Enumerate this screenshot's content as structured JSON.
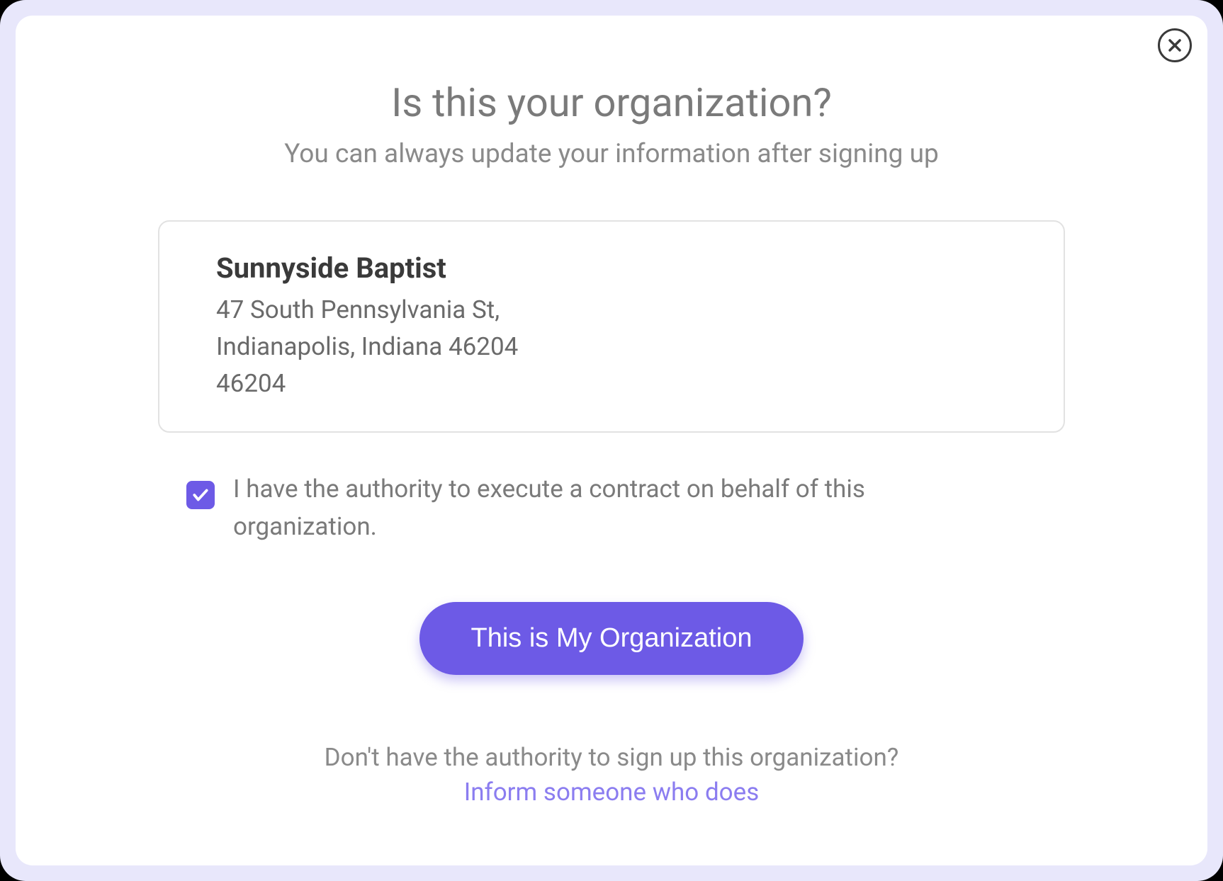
{
  "modal": {
    "title": "Is this your organization?",
    "subtitle": "You can always update your information after signing up",
    "organization": {
      "name": "Sunnyside Baptist",
      "address_line1": "47 South Pennsylvania St,",
      "address_line2": "Indianapolis, Indiana 46204",
      "address_line3": "46204"
    },
    "authority_checkbox": {
      "checked": true,
      "label": "I have the authority to execute a contract on behalf of this organization."
    },
    "confirm_button": "This is My Organization",
    "footer": {
      "question": "Don't have the authority to sign up this organization?",
      "link": "Inform someone who does"
    }
  },
  "colors": {
    "accent": "#6d5ae6",
    "backdrop": "#e8e7fb",
    "text_muted": "#7a7a7a",
    "link": "#8b7df0"
  }
}
